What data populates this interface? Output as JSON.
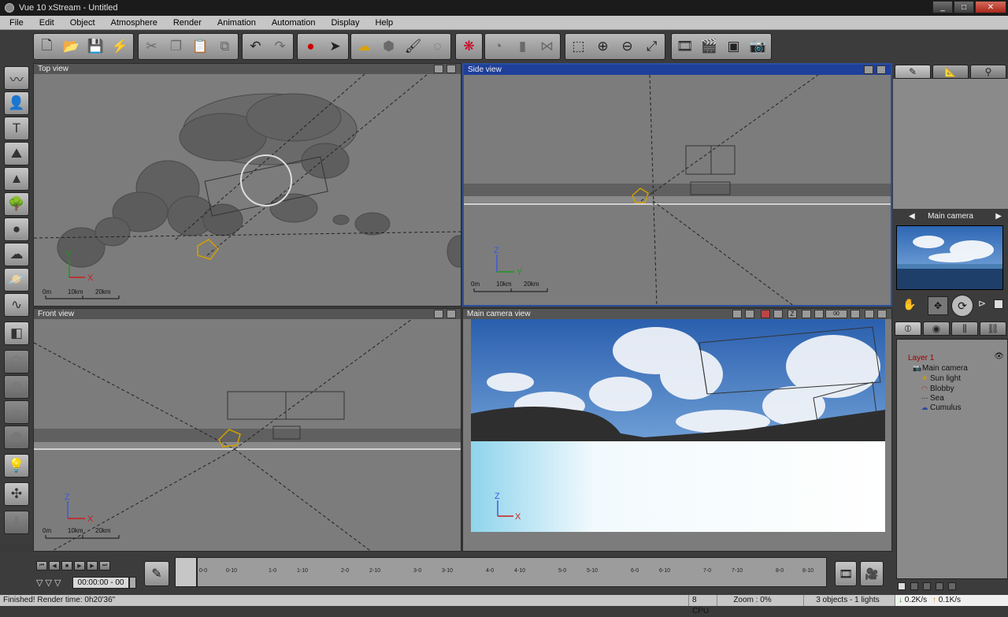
{
  "window": {
    "title": "Vue 10 xStream - Untitled",
    "minimize": "_",
    "maximize": "□",
    "close": "✕"
  },
  "menu": [
    "File",
    "Edit",
    "Object",
    "Atmosphere",
    "Render",
    "Animation",
    "Automation",
    "Display",
    "Help"
  ],
  "toolbar": {
    "icons": [
      "new-file-icon",
      "open-folder-icon",
      "save-icon",
      "save-lightning-icon",
      "cut-icon",
      "copy-icon",
      "paste-icon",
      "duplicate-icon",
      "undo-icon",
      "redo-icon",
      "render-record-icon",
      "select-arrow-icon",
      "atmosphere-icon",
      "object-cube-icon",
      "brush-icon",
      "drop-icon",
      "color-balls-icon",
      "speedometer-icon",
      "bars-icon",
      "mirror-icon",
      "zoom-select-icon",
      "zoom-in-icon",
      "zoom-out-icon",
      "fit-icon",
      "film-strip-icon",
      "clapperboard-icon",
      "frame-icon",
      "camera-icon"
    ]
  },
  "viewports": {
    "top": {
      "title": "Top view",
      "axis1": "Y",
      "axis2": "X"
    },
    "side": {
      "title": "Side view",
      "axis1": "Z",
      "axis2": "Y"
    },
    "front": {
      "title": "Front view",
      "axis1": "Z",
      "axis2": "X"
    },
    "camera": {
      "title": "Main camera view",
      "axis1": "Z",
      "axis2": "X",
      "frame_field": "00"
    },
    "scale": [
      "0m",
      "10km",
      "20km"
    ]
  },
  "timeline": {
    "time": "00:00:00 - 00",
    "ticks": [
      "0-0",
      "0-10",
      "1-0",
      "1-10",
      "2-0",
      "2-10",
      "3-0",
      "3-10",
      "4-0",
      "4-10",
      "5-0",
      "5-10",
      "6-0",
      "6-10",
      "7-0",
      "7-10",
      "8-0",
      "8-10"
    ]
  },
  "right_panel": {
    "camera_label": "Main camera",
    "scene_tree": {
      "layer": "Layer 1",
      "items": [
        "Main camera",
        "Sun light",
        "Blobby",
        "Sea",
        "Cumulus"
      ]
    }
  },
  "status": {
    "message": "Finished! Render time: 0h20'36\"",
    "cpu": "8 CPU",
    "zoom": "Zoom : 0%",
    "objects": "3 objects - 1 lights",
    "net_down": "0.2K/s",
    "net_up": "0.1K/s"
  }
}
